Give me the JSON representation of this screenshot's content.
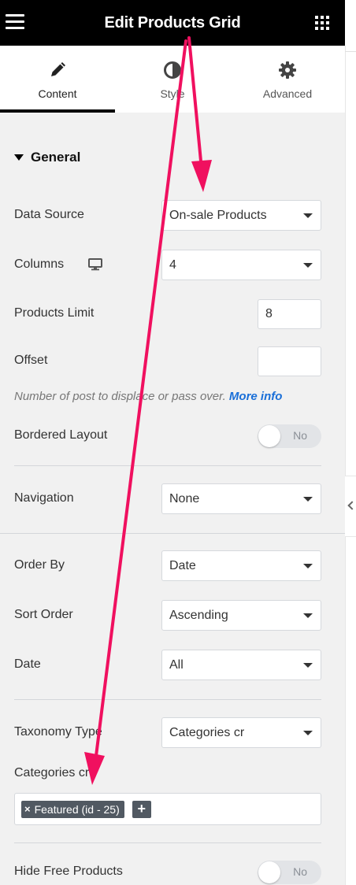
{
  "header": {
    "title": "Edit Products Grid",
    "menu_icon": "hamburger-icon",
    "apps_icon": "grid-icon"
  },
  "tabs": [
    {
      "label": "Content",
      "icon": "pencil-icon",
      "active": true
    },
    {
      "label": "Style",
      "icon": "contrast-icon",
      "active": false
    },
    {
      "label": "Advanced",
      "icon": "gear-icon",
      "active": false
    }
  ],
  "section": {
    "title": "General"
  },
  "fields": {
    "data_source": {
      "label": "Data Source",
      "value": "On-sale Products"
    },
    "columns": {
      "label": "Columns",
      "value": "4",
      "device_icon": "desktop-icon"
    },
    "products_limit": {
      "label": "Products Limit",
      "value": "8"
    },
    "offset": {
      "label": "Offset",
      "value": ""
    },
    "offset_hint": {
      "text": "Number of post to displace or pass over.",
      "link": "More info"
    },
    "bordered_layout": {
      "label": "Bordered Layout",
      "toggle": "No"
    },
    "navigation": {
      "label": "Navigation",
      "value": "None"
    },
    "order_by": {
      "label": "Order By",
      "value": "Date"
    },
    "sort_order": {
      "label": "Sort Order",
      "value": "Ascending"
    },
    "date": {
      "label": "Date",
      "value": "All"
    },
    "taxonomy_type": {
      "label": "Taxonomy Type",
      "value": "Categories cr"
    },
    "categories": {
      "label": "Categories cr",
      "chip": "Featured (id - 25)",
      "remove": "×",
      "add": "+"
    },
    "hide_free": {
      "label": "Hide Free Products",
      "toggle": "No"
    }
  },
  "colors": {
    "accent_arrow": "#f0105f",
    "link": "#1a6fd8",
    "topbar": "#000000"
  }
}
